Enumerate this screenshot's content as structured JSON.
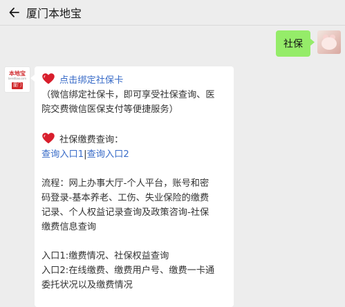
{
  "header": {
    "title": "厦门本地宝"
  },
  "user_message": {
    "text": "社保"
  },
  "bot_avatar": {
    "logo_text": "本地宝",
    "logo_sub": "bendibao.com",
    "city": "厦门"
  },
  "bot_message": {
    "bind_link": "点击绑定社保卡",
    "bind_desc": [
      "（微信绑定社保卡，即可享受社保查询、医",
      "院交费微信医保支付等便捷服务）"
    ],
    "query_title": "社保缴费查询：",
    "query_link1": "查询入口1",
    "query_link_sep": "|",
    "query_link2": "查询入口2",
    "process": [
      "流程：网上办事大厅-个人平台，账号和密",
      "码登录-基本养老、工伤、失业保险的缴费",
      "记录、个人权益记录查询及政策咨询-社保",
      "缴费信息查询"
    ],
    "entry": [
      "入口1:缴费情况、社保权益查询",
      "入口2:在线缴费、缴费用户号、缴费一卡通",
      "委托状况以及缴费情况"
    ]
  },
  "colors": {
    "link": "#3a6cc8",
    "user_bubble": "#95ec69",
    "heart": "#d81e2c"
  }
}
